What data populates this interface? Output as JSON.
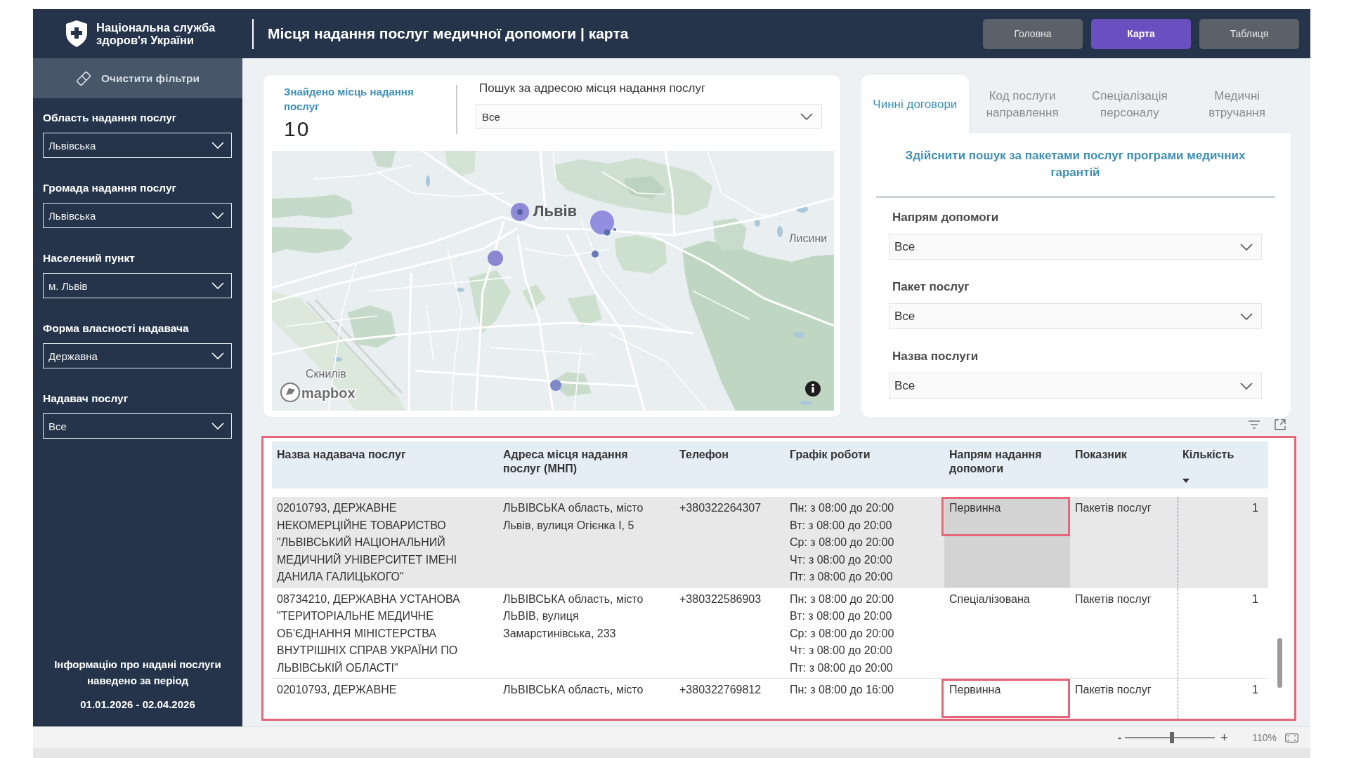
{
  "header": {
    "logo_text": "Національна служба здоров'я України",
    "title": "Місця надання послуг медичної допомоги | карта",
    "nav": [
      {
        "label": "Головна",
        "selected": false
      },
      {
        "label": "Карта",
        "selected": true
      },
      {
        "label": "Таблиця",
        "selected": false
      }
    ]
  },
  "sidebar": {
    "clear_button": "Очистити фільтри",
    "filters": [
      {
        "label": "Область надання послуг",
        "value": "Львівська"
      },
      {
        "label": "Громада надання послуг",
        "value": "Львівська"
      },
      {
        "label": "Населений пункт",
        "value": "м. Львів"
      },
      {
        "label": "Форма власності надавача",
        "value": "Державна"
      },
      {
        "label": "Надавач послуг",
        "value": "Все"
      }
    ],
    "period_note": "Інформацію про надані послуги наведено за період",
    "period": "01.01.2026 - 02.04.2026"
  },
  "summary": {
    "found_label": "Знайдено місць надання послуг",
    "found_count": "10",
    "search_label": "Пошук за адресою місця надання послуг",
    "search_value": "Все"
  },
  "map": {
    "places": [
      {
        "name": "Львів",
        "kind": "city"
      },
      {
        "name": "Лисини",
        "kind": "village"
      },
      {
        "name": "Скнилів",
        "kind": "village"
      }
    ],
    "attribution": "mapbox"
  },
  "service_panel": {
    "tabs": [
      {
        "label": "Чинні договори",
        "selected": true
      },
      {
        "label": "Код послуги направлення",
        "selected": false
      },
      {
        "label": "Спеціалізація персоналу",
        "selected": false
      },
      {
        "label": "Медичні втручання",
        "selected": false
      }
    ],
    "heading": "Здійснити пошук за пакетами послуг програми медичних гарантій",
    "filters": [
      {
        "label": "Напрям допомоги",
        "value": "Все"
      },
      {
        "label": "Пакет послуг",
        "value": "Все"
      },
      {
        "label": "Назва послуги",
        "value": "Все"
      }
    ]
  },
  "table": {
    "highlighted": true,
    "columns": [
      {
        "label": "Назва надавача послуг",
        "sorted": false
      },
      {
        "label": "Адреса місця надання послуг (МНП)",
        "sorted": false
      },
      {
        "label": "Телефон",
        "sorted": false
      },
      {
        "label": "Графік роботи",
        "sorted": false
      },
      {
        "label": "Напрям надання допомоги",
        "sorted": false
      },
      {
        "label": "Показник",
        "sorted": false
      },
      {
        "label": "Кількість",
        "sorted": true
      }
    ],
    "rows": [
      {
        "selected": true,
        "provider": "02010793, ДЕРЖАВНЕ НЕКОМЕРЦІЙНЕ ТОВАРИСТВО \"ЛЬВІВСЬКИЙ НАЦІОНАЛЬНИЙ МЕДИЧНИЙ УНІВЕРСИТЕТ ІМЕНІ ДАНИЛА ГАЛИЦЬКОГО\"",
        "address": "ЛЬВІВСЬКА область, місто Львів, вулиця Огієнка І, 5",
        "phone": "+380322264307",
        "schedule": "Пн: з 08:00 до 20:00\nВт: з 08:00 до 20:00\nСр: з 08:00 до 20:00\nЧт: з 08:00 до 20:00\nПт: з 08:00 до 20:00",
        "direction": {
          "text": "Первинна",
          "focused": true,
          "highlighted": true
        },
        "indicator": "Пакетів послуг",
        "quantity": "1"
      },
      {
        "selected": false,
        "provider": "08734210, ДЕРЖАВНА УСТАНОВА \"ТЕРИТОРІАЛЬНЕ МЕДИЧНЕ ОБ'ЄДНАННЯ МІНІСТЕРСТВА ВНУТРІШНІХ СПРАВ УКРАЇНИ ПО ЛЬВІВСЬКІЙ ОБЛАСТІ\"",
        "address": "ЛЬВІВСЬКА область, місто ЛЬВІВ, вулиця Замарстинівська, 233",
        "phone": "+380322586903",
        "schedule": "Пн: з 08:00 до 20:00\nВт: з 08:00 до 20:00\nСр: з 08:00 до 20:00\nЧт: з 08:00 до 20:00\nПт: з 08:00 до 20:00",
        "direction": {
          "text": "Спеціалізована",
          "focused": false,
          "highlighted": false
        },
        "indicator": "Пакетів послуг",
        "quantity": "1"
      },
      {
        "selected": false,
        "provider": "02010793, ДЕРЖАВНЕ",
        "address": "ЛЬВІВСЬКА область, місто",
        "phone": "+380322769812",
        "schedule": "Пн: з 08:00 до 16:00",
        "direction": {
          "text": "Первинна",
          "focused": false,
          "highlighted": true
        },
        "indicator": "Пакетів послуг",
        "quantity": "1"
      }
    ]
  },
  "zoom": {
    "zoom_out": "-",
    "level": 0.52,
    "zoom_in": "+",
    "reading": "110%"
  }
}
